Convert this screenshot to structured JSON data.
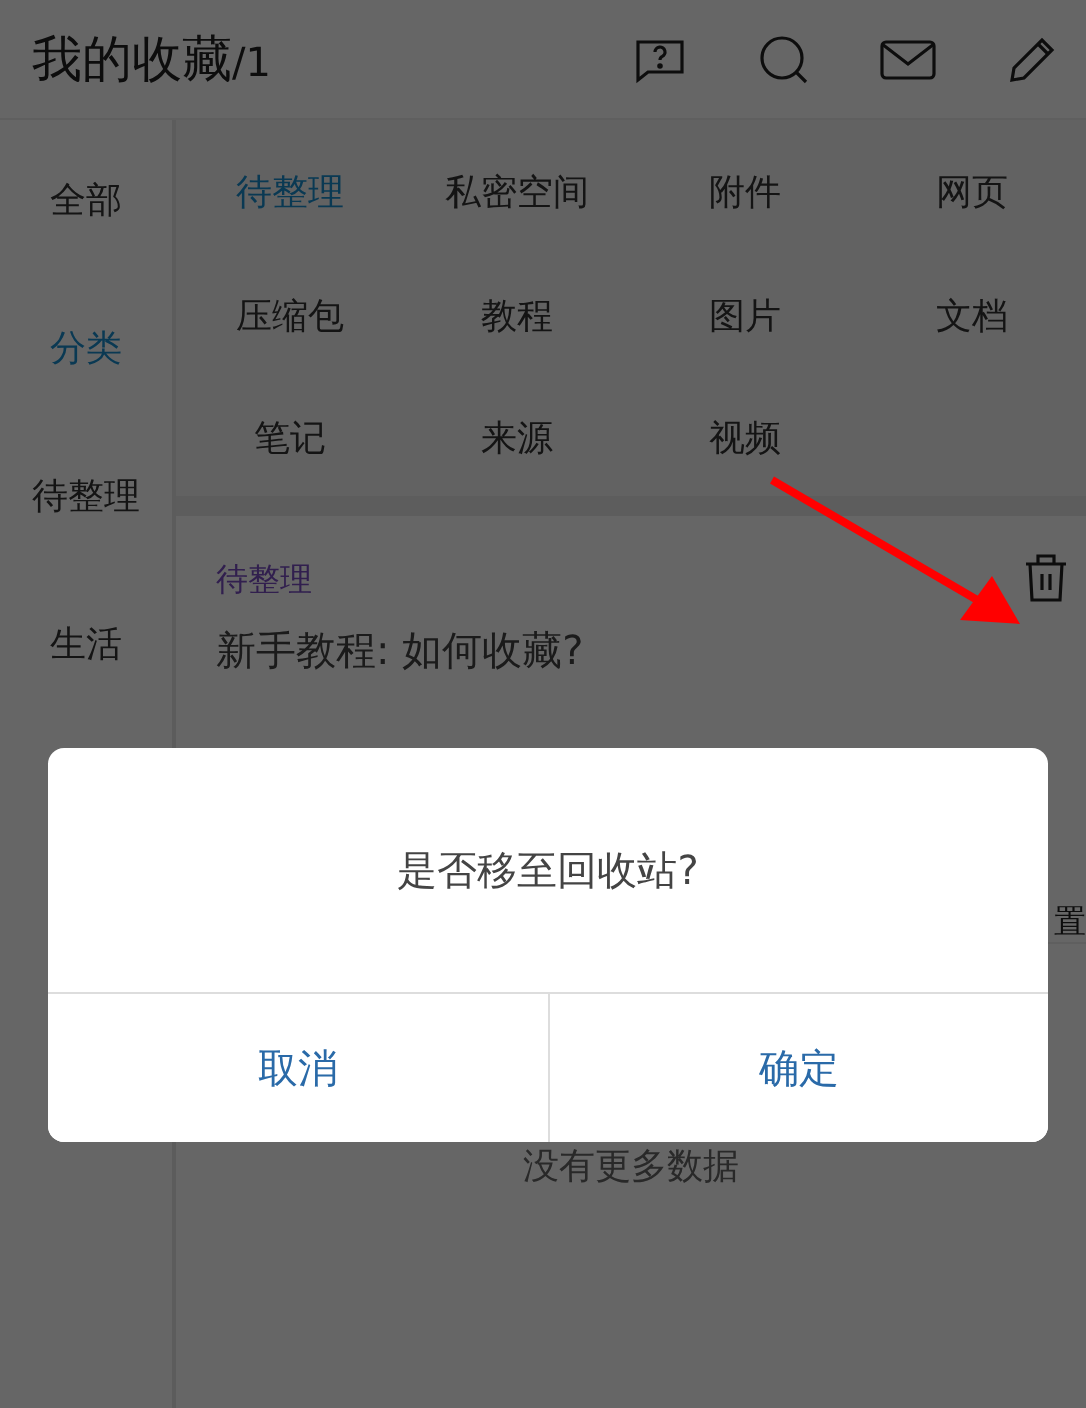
{
  "header": {
    "title": "我的收藏",
    "count": "/1"
  },
  "sidebar": {
    "items": [
      {
        "label": "全部",
        "selected": false
      },
      {
        "label": "分类",
        "selected": true
      },
      {
        "label": "待整理",
        "selected": false
      },
      {
        "label": "生活",
        "selected": false
      }
    ]
  },
  "categories": [
    {
      "label": "待整理",
      "selected": true
    },
    {
      "label": "私密空间",
      "selected": false
    },
    {
      "label": "附件",
      "selected": false
    },
    {
      "label": "网页",
      "selected": false
    },
    {
      "label": "压缩包",
      "selected": false
    },
    {
      "label": "教程",
      "selected": false
    },
    {
      "label": "图片",
      "selected": false
    },
    {
      "label": "文档",
      "selected": false
    },
    {
      "label": "笔记",
      "selected": false
    },
    {
      "label": "来源",
      "selected": false
    },
    {
      "label": "视频",
      "selected": false
    }
  ],
  "items": [
    {
      "tag": "待整理",
      "title": "新手教程: 如何收藏?",
      "action_fragment": "置"
    }
  ],
  "footer": "没有更多数据",
  "dialog": {
    "message": "是否移至回收站?",
    "buttons": [
      "取消",
      "确定"
    ]
  }
}
